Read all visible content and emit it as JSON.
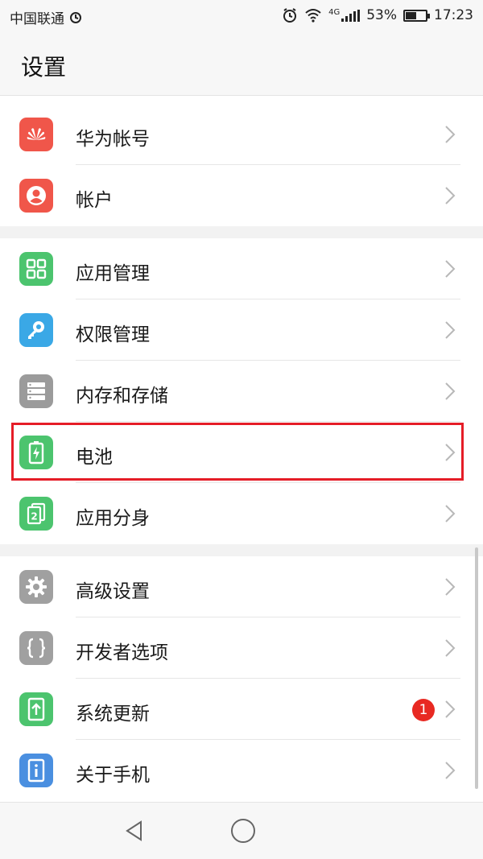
{
  "status_bar": {
    "carrier": "中国联通",
    "battery_percent": "53%",
    "battery_level": 0.53,
    "time": "17:23",
    "network": "4G"
  },
  "header": {
    "title": "设置"
  },
  "groups": [
    {
      "items": [
        {
          "id": "huawei-account",
          "label": "华为帐号",
          "icon": "huawei-logo-icon",
          "color": "#f0564a"
        },
        {
          "id": "accounts",
          "label": "帐户",
          "icon": "person-icon",
          "color": "#f0564a"
        }
      ]
    },
    {
      "items": [
        {
          "id": "app-management",
          "label": "应用管理",
          "icon": "grid-icon",
          "color": "#4cc46e"
        },
        {
          "id": "permissions",
          "label": "权限管理",
          "icon": "key-icon",
          "color": "#3aa8e6"
        },
        {
          "id": "storage",
          "label": "内存和存储",
          "icon": "storage-icon",
          "color": "#9b9b9b"
        },
        {
          "id": "battery",
          "label": "电池",
          "icon": "battery-icon",
          "color": "#4cc46e"
        },
        {
          "id": "app-twin",
          "label": "应用分身",
          "icon": "app-twin-icon",
          "color": "#4cc46e"
        }
      ]
    },
    {
      "items": [
        {
          "id": "advanced",
          "label": "高级设置",
          "icon": "gear-icon",
          "color": "#a0a0a0"
        },
        {
          "id": "developer",
          "label": "开发者选项",
          "icon": "braces-icon",
          "color": "#a0a0a0"
        },
        {
          "id": "system-update",
          "label": "系统更新",
          "icon": "upload-icon",
          "color": "#4cc46e",
          "badge": "1"
        },
        {
          "id": "about-phone",
          "label": "关于手机",
          "icon": "info-icon",
          "color": "#4a8fe0"
        }
      ]
    }
  ],
  "highlight_item": "battery"
}
